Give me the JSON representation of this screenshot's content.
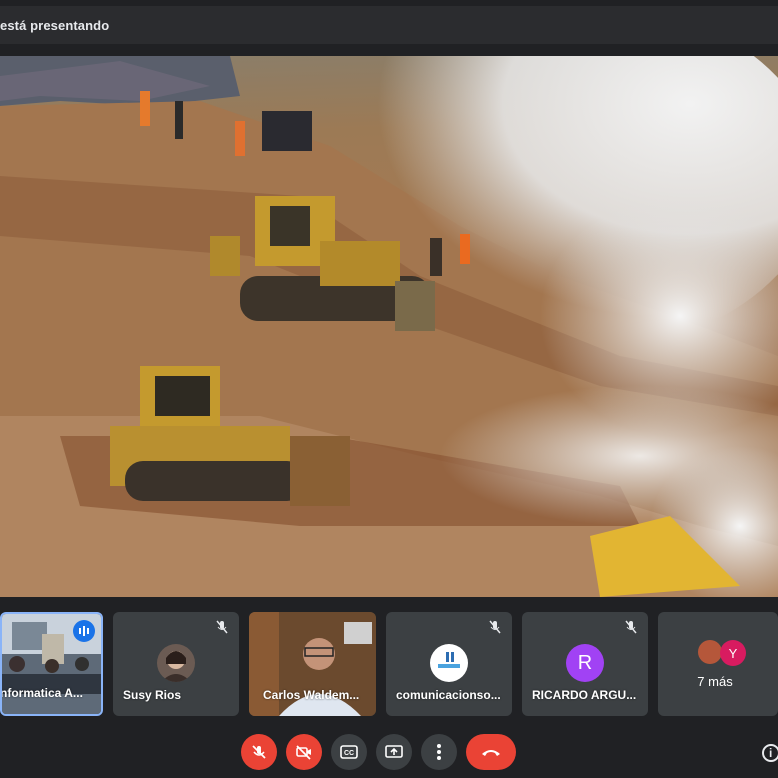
{
  "header": {
    "presenter_text": "está presentando"
  },
  "tiles": [
    {
      "name": "nformatica A...",
      "muted": false,
      "active": true
    },
    {
      "name": "Susy Rios",
      "muted": true
    },
    {
      "name": "Carlos Waldem...",
      "muted": false
    },
    {
      "name": "comunicacionso...",
      "muted": true
    },
    {
      "name": "RICARDO ARGU...",
      "muted": true,
      "initial": "R"
    },
    {
      "more_label": "7 más",
      "initial": "Y"
    }
  ],
  "controls": {
    "items": [
      "mic-off",
      "camera-off",
      "captions",
      "present",
      "more-options",
      "hang-up"
    ]
  },
  "colors": {
    "accent": "#8ab4f8",
    "danger": "#ea4335",
    "tile_bg": "#3c4043",
    "avatar_purple": "#a142f4",
    "avatar_pink": "#d81b60"
  }
}
